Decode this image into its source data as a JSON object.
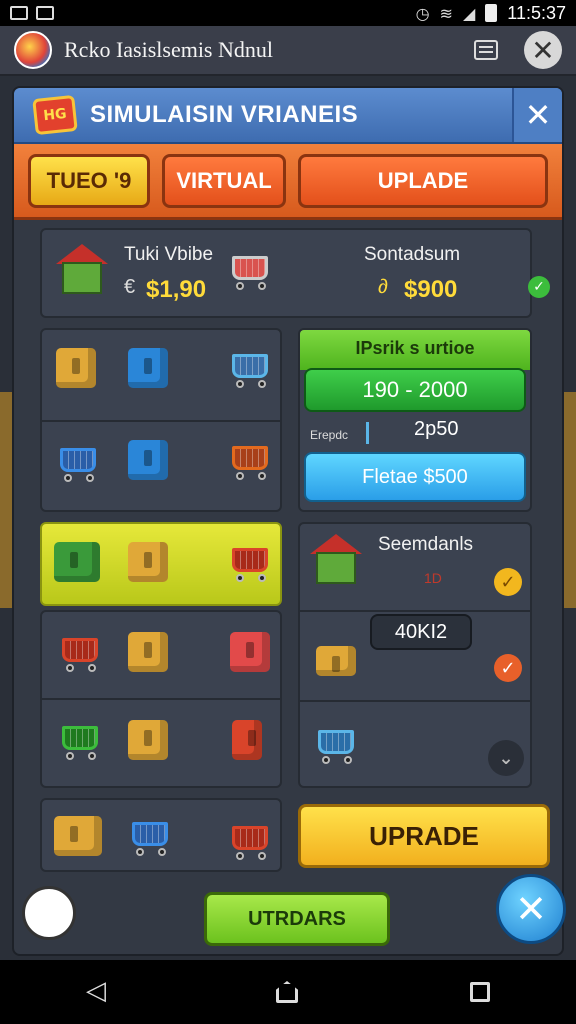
{
  "status_bar": {
    "time": "11:5:37"
  },
  "app_bar": {
    "title": "Rcko Iasislsemis Ndnul"
  },
  "dialog": {
    "badge": "HG",
    "title": "SIMULAISIN VRIANEIS",
    "tabs": [
      "TUEO '9",
      "VIRTUAL",
      "UPLADE"
    ]
  },
  "summary": {
    "left_label": "Tuki Vbibe",
    "left_value": "$1,90",
    "left_symbol": "€",
    "right_label": "Sontadsum",
    "right_symbol": "∂",
    "right_value": "$900"
  },
  "offer_panel": {
    "header": "IPsrik s urtioe",
    "range": "190 - 2000",
    "small_label": "Erepdc",
    "small_value": "2p50",
    "button": "Fletae $500"
  },
  "side_panel": {
    "label": "Seemdanls",
    "mark": "1D",
    "value_box": "40KI2"
  },
  "footer": {
    "upgrade_button": "UPRADE",
    "secondary_button": "UTRDARS"
  },
  "colors": {
    "accent_orange": "#e3641f",
    "accent_yellow": "#f9c52a",
    "green": "#3cbd3c",
    "blue": "#3aa8e8",
    "panel": "#3b4250"
  }
}
